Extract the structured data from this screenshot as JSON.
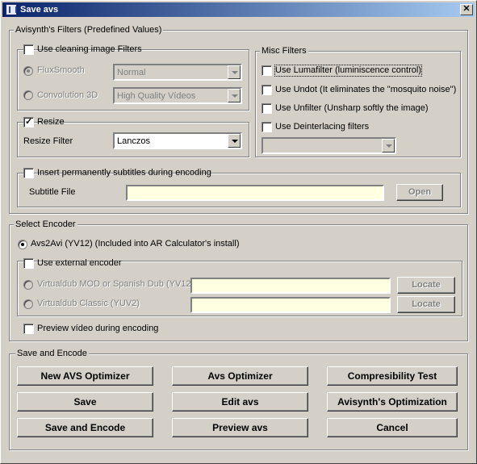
{
  "window": {
    "title": "Save avs",
    "close_glyph": "✕"
  },
  "filters": {
    "legend": "Avisynth's Filters (Predefined Values)",
    "cleaning": {
      "label": "Use cleaning image Filters",
      "checked": false,
      "fluxsmooth": {
        "label": "FluxSmooth",
        "selected": true,
        "value": "Normal"
      },
      "convolution": {
        "label": "Convolution 3D",
        "selected": false,
        "value": "High Quality Vídeos"
      }
    },
    "resize": {
      "label": "Resize",
      "checked": true,
      "filter_label": "Resize Filter",
      "filter_value": "Lanczos"
    },
    "misc": {
      "legend": "Misc Filters",
      "items": [
        {
          "label": "Use Lumafilter (luminiscence control)",
          "checked": false
        },
        {
          "label": "Use Undot (It eliminates the \"mosquito noise\")",
          "checked": false
        },
        {
          "label": "Use Unfilter (Unsharp softly the image)",
          "checked": false
        },
        {
          "label": "Use Deinterlacing filters",
          "checked": false
        }
      ],
      "deinterlace_value": ""
    },
    "subtitles": {
      "label": "Insert permanently subtitles during encoding",
      "checked": false,
      "file_label": "Subtitle File",
      "file_value": "",
      "open_label": "Open"
    }
  },
  "encoder": {
    "legend": "Select Encoder",
    "avs2avi_label": "Avs2Avi (YV12) (Included into AR Calculator's install)",
    "avs2avi_selected": true,
    "external": {
      "label": "Use external encoder",
      "checked": false,
      "options": [
        {
          "label": "Virtualdub MOD or Spanish Dub (YV12)",
          "path": "",
          "locate_label": "Locate"
        },
        {
          "label": "Virtualdub Classic (YUV2)",
          "path": "",
          "locate_label": "Locate"
        }
      ]
    },
    "preview": {
      "label": "Preview vídeo during encoding",
      "checked": false
    }
  },
  "actions": {
    "legend": "Save and Encode",
    "buttons": [
      "New AVS Optimizer",
      "Avs Optimizer",
      "Compresibility Test",
      "Save",
      "Edit avs",
      "Avisynth's Optimization",
      "Save and Encode",
      "Preview avs",
      "Cancel"
    ]
  }
}
